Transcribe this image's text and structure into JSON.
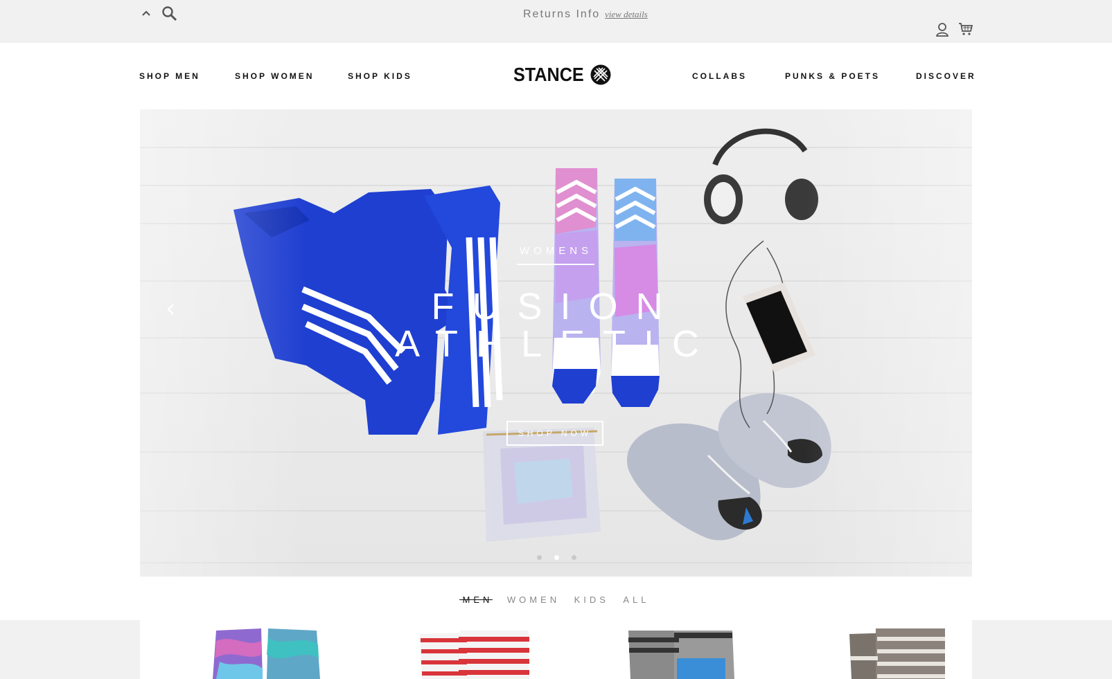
{
  "topbar": {
    "returns_text": "Returns Info",
    "view_details": "view details"
  },
  "nav": {
    "left": [
      "SHOP MEN",
      "SHOP WOMEN",
      "SHOP KIDS"
    ],
    "logo_text": "STANCE",
    "right": [
      "COLLABS",
      "PUNKS & POETS",
      "DISCOVER"
    ]
  },
  "hero": {
    "eyebrow": "WOMENS",
    "title_line1": "FUSION",
    "title_line2": "ATHLETIC",
    "cta": "SHOP NOW",
    "slides": 3,
    "active_slide": 2
  },
  "filter": {
    "items": [
      "MEN",
      "WOMEN",
      "KIDS",
      "ALL"
    ],
    "active": "MEN"
  },
  "colors": {
    "topbar_bg": "#f1f1f1",
    "accent_blue": "#1f3fd1"
  }
}
